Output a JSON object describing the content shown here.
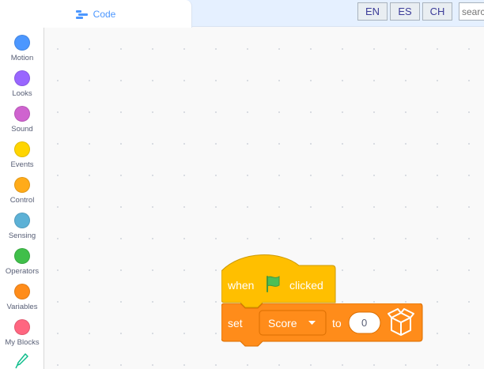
{
  "tabs": {
    "code_label": "Code"
  },
  "languages": [
    "EN",
    "ES",
    "CH"
  ],
  "search": {
    "placeholder": "search"
  },
  "categories": [
    {
      "label": "Motion",
      "color": "#4c97ff"
    },
    {
      "label": "Looks",
      "color": "#9966ff"
    },
    {
      "label": "Sound",
      "color": "#cf63cf"
    },
    {
      "label": "Events",
      "color": "#ffd500"
    },
    {
      "label": "Control",
      "color": "#ffab19"
    },
    {
      "label": "Sensing",
      "color": "#5cb1d6"
    },
    {
      "label": "Operators",
      "color": "#40bf4a"
    },
    {
      "label": "Variables",
      "color": "#ff8c1a"
    },
    {
      "label": "My Blocks",
      "color": "#ff6680"
    }
  ],
  "blocks": {
    "hat": {
      "word1": "when",
      "word2": "clicked",
      "color": "#ffbf00",
      "flag_icon": "green-flag-icon"
    },
    "set": {
      "word1": "set",
      "variable": "Score",
      "word2": "to",
      "value": "0",
      "color": "#ff8c1a",
      "extension_icon": "box-icon"
    }
  }
}
